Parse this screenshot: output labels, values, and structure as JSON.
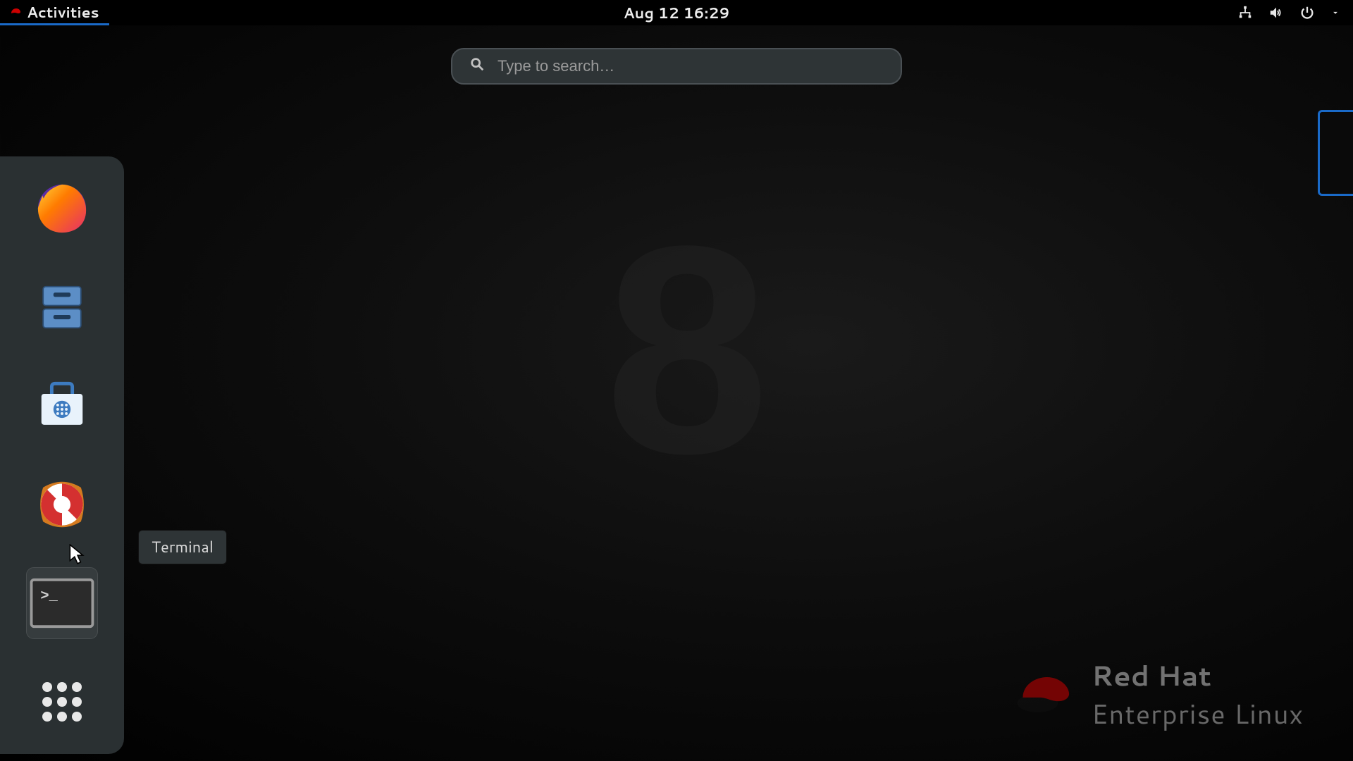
{
  "topbar": {
    "activities_label": "Activities",
    "clock": "Aug 12  16:29"
  },
  "search": {
    "placeholder": "Type to search…",
    "value": ""
  },
  "dock": {
    "items": [
      {
        "name": "firefox",
        "tooltip": "Firefox"
      },
      {
        "name": "files",
        "tooltip": "Files"
      },
      {
        "name": "software",
        "tooltip": "Software"
      },
      {
        "name": "help",
        "tooltip": "Help"
      },
      {
        "name": "terminal",
        "tooltip": "Terminal"
      },
      {
        "name": "show-apps",
        "tooltip": "Show Applications"
      }
    ],
    "hovered_index": 4
  },
  "tooltip_text": "Terminal",
  "background_glyph": "8",
  "brand": {
    "line1_bold": "Red Hat",
    "line2": "Enterprise Linux"
  }
}
